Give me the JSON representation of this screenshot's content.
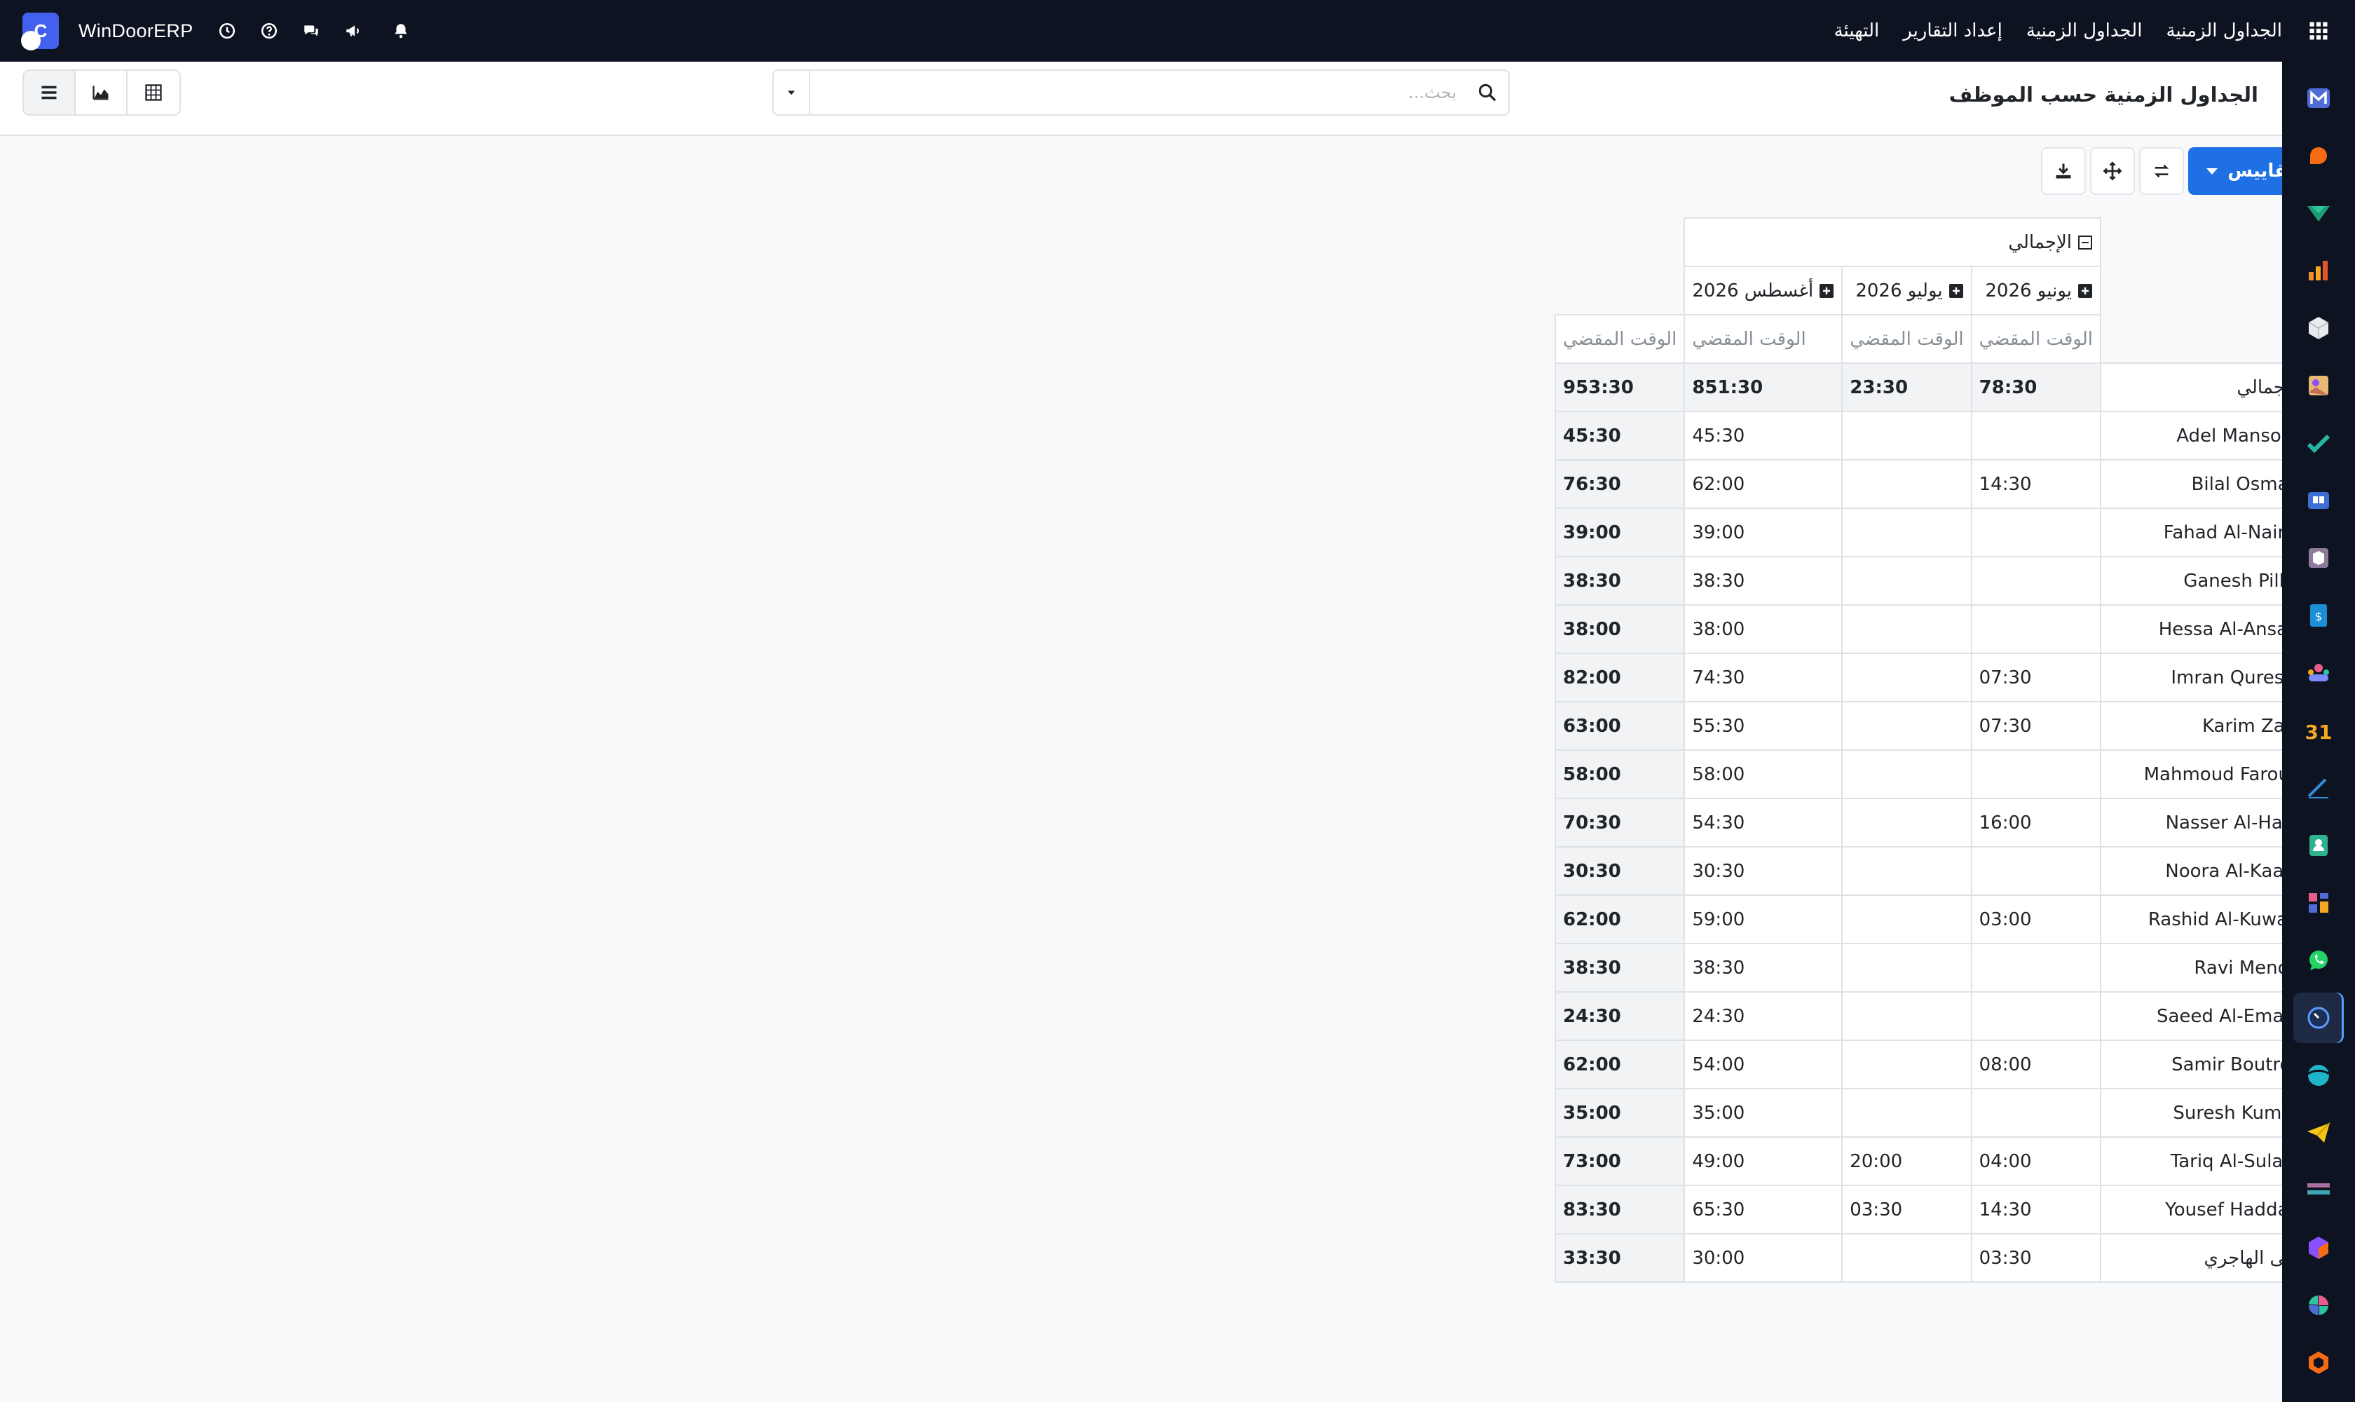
{
  "topbar": {
    "brand": "WinDoorERP",
    "menu": [
      "الجداول الزمنية",
      "الجداول الزمنية",
      "إعداد التقارير",
      "التهيئة"
    ]
  },
  "control": {
    "title": "الجداول الزمنية حسب الموظف",
    "search_placeholder": "بحث..."
  },
  "toolbar": {
    "measures_label": "المقاييس"
  },
  "pivot": {
    "total_label": "الإجمالي",
    "columns": [
      "يونيو 2026",
      "يوليو 2026",
      "أغسطس 2026"
    ],
    "measure_label": "الوقت المقضي",
    "grand_total": [
      "78:30",
      "23:30",
      "851:30",
      "953:30"
    ],
    "rows": [
      {
        "name": "Adel Mansour",
        "values": [
          "",
          "",
          "45:30"
        ],
        "total": "45:30"
      },
      {
        "name": "Bilal Osman",
        "values": [
          "14:30",
          "",
          "62:00"
        ],
        "total": "76:30"
      },
      {
        "name": "Fahad Al-Naimi",
        "values": [
          "",
          "",
          "39:00"
        ],
        "total": "39:00"
      },
      {
        "name": "Ganesh Pillai",
        "values": [
          "",
          "",
          "38:30"
        ],
        "total": "38:30"
      },
      {
        "name": "Hessa Al-Ansari",
        "values": [
          "",
          "",
          "38:00"
        ],
        "total": "38:00"
      },
      {
        "name": "Imran Qureshi",
        "values": [
          "07:30",
          "",
          "74:30"
        ],
        "total": "82:00"
      },
      {
        "name": "Karim Zaki",
        "values": [
          "07:30",
          "",
          "55:30"
        ],
        "total": "63:00"
      },
      {
        "name": "Mahmoud Farouk",
        "values": [
          "",
          "",
          "58:00"
        ],
        "total": "58:00"
      },
      {
        "name": "Nasser Al-Hajri",
        "values": [
          "16:00",
          "",
          "54:30"
        ],
        "total": "70:30"
      },
      {
        "name": "Noora Al-Kaabi",
        "values": [
          "",
          "",
          "30:30"
        ],
        "total": "30:30"
      },
      {
        "name": "Rashid Al-Kuwari",
        "values": [
          "03:00",
          "",
          "59:00"
        ],
        "total": "62:00"
      },
      {
        "name": "Ravi Menon",
        "values": [
          "",
          "",
          "38:30"
        ],
        "total": "38:30"
      },
      {
        "name": "Saeed Al-Emadi",
        "values": [
          "",
          "",
          "24:30"
        ],
        "total": "24:30"
      },
      {
        "name": "Samir Boutros",
        "values": [
          "08:00",
          "",
          "54:00"
        ],
        "total": "62:00"
      },
      {
        "name": "Suresh Kumar",
        "values": [
          "",
          "",
          "35:00"
        ],
        "total": "35:00"
      },
      {
        "name": "Tariq Al-Sulaiti",
        "values": [
          "04:00",
          "20:00",
          "49:00"
        ],
        "total": "73:00"
      },
      {
        "name": "Yousef Haddad",
        "values": [
          "14:30",
          "03:30",
          "65:30"
        ],
        "total": "83:30"
      },
      {
        "name": "منى الهاجري",
        "values": [
          "03:30",
          "",
          "30:00"
        ],
        "total": "33:30"
      }
    ]
  },
  "sidebar": {
    "apps": [
      "mail-app",
      "discuss-app",
      "crm-app",
      "sales-app",
      "inventory-app",
      "photo-app",
      "todo-app",
      "knowledge-app",
      "purchase-app",
      "invoicing-app",
      "employees-app",
      "calendar-app",
      "sign-app",
      "contacts-app",
      "dashboards-app",
      "whatsapp-app",
      "timesheets-app",
      "website-app",
      "email-marketing-app",
      "documents-app",
      "product-app",
      "studio-app",
      "marketplace-app"
    ],
    "active": "timesheets-app"
  }
}
